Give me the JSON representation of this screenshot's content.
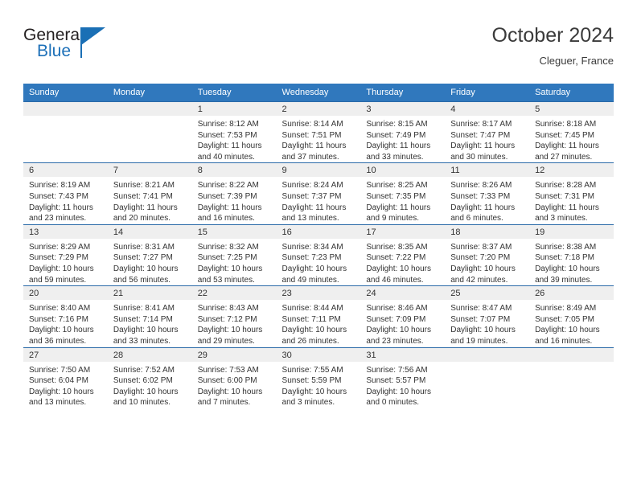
{
  "brand": {
    "name_part1": "General",
    "name_part2": "Blue",
    "flag_icon": "triangle-flag-icon"
  },
  "header": {
    "month_title": "October 2024",
    "location": "Cleguer, France"
  },
  "colors": {
    "header_blue": "#3078bd",
    "row_divider": "#2a6aa8",
    "daynum_band": "#efefef",
    "brand_blue": "#1d70b8",
    "text": "#333333"
  },
  "calendar": {
    "weekday_headers": [
      "Sunday",
      "Monday",
      "Tuesday",
      "Wednesday",
      "Thursday",
      "Friday",
      "Saturday"
    ],
    "labels": {
      "sunrise": "Sunrise:",
      "sunset": "Sunset:",
      "daylight": "Daylight:"
    },
    "weeks": [
      [
        {
          "day": "",
          "sunrise": "",
          "sunset": "",
          "daylight": "",
          "empty": true
        },
        {
          "day": "",
          "sunrise": "",
          "sunset": "",
          "daylight": "",
          "empty": true
        },
        {
          "day": "1",
          "sunrise": "Sunrise: 8:12 AM",
          "sunset": "Sunset: 7:53 PM",
          "daylight": "Daylight: 11 hours and 40 minutes."
        },
        {
          "day": "2",
          "sunrise": "Sunrise: 8:14 AM",
          "sunset": "Sunset: 7:51 PM",
          "daylight": "Daylight: 11 hours and 37 minutes."
        },
        {
          "day": "3",
          "sunrise": "Sunrise: 8:15 AM",
          "sunset": "Sunset: 7:49 PM",
          "daylight": "Daylight: 11 hours and 33 minutes."
        },
        {
          "day": "4",
          "sunrise": "Sunrise: 8:17 AM",
          "sunset": "Sunset: 7:47 PM",
          "daylight": "Daylight: 11 hours and 30 minutes."
        },
        {
          "day": "5",
          "sunrise": "Sunrise: 8:18 AM",
          "sunset": "Sunset: 7:45 PM",
          "daylight": "Daylight: 11 hours and 27 minutes."
        }
      ],
      [
        {
          "day": "6",
          "sunrise": "Sunrise: 8:19 AM",
          "sunset": "Sunset: 7:43 PM",
          "daylight": "Daylight: 11 hours and 23 minutes."
        },
        {
          "day": "7",
          "sunrise": "Sunrise: 8:21 AM",
          "sunset": "Sunset: 7:41 PM",
          "daylight": "Daylight: 11 hours and 20 minutes."
        },
        {
          "day": "8",
          "sunrise": "Sunrise: 8:22 AM",
          "sunset": "Sunset: 7:39 PM",
          "daylight": "Daylight: 11 hours and 16 minutes."
        },
        {
          "day": "9",
          "sunrise": "Sunrise: 8:24 AM",
          "sunset": "Sunset: 7:37 PM",
          "daylight": "Daylight: 11 hours and 13 minutes."
        },
        {
          "day": "10",
          "sunrise": "Sunrise: 8:25 AM",
          "sunset": "Sunset: 7:35 PM",
          "daylight": "Daylight: 11 hours and 9 minutes."
        },
        {
          "day": "11",
          "sunrise": "Sunrise: 8:26 AM",
          "sunset": "Sunset: 7:33 PM",
          "daylight": "Daylight: 11 hours and 6 minutes."
        },
        {
          "day": "12",
          "sunrise": "Sunrise: 8:28 AM",
          "sunset": "Sunset: 7:31 PM",
          "daylight": "Daylight: 11 hours and 3 minutes."
        }
      ],
      [
        {
          "day": "13",
          "sunrise": "Sunrise: 8:29 AM",
          "sunset": "Sunset: 7:29 PM",
          "daylight": "Daylight: 10 hours and 59 minutes."
        },
        {
          "day": "14",
          "sunrise": "Sunrise: 8:31 AM",
          "sunset": "Sunset: 7:27 PM",
          "daylight": "Daylight: 10 hours and 56 minutes."
        },
        {
          "day": "15",
          "sunrise": "Sunrise: 8:32 AM",
          "sunset": "Sunset: 7:25 PM",
          "daylight": "Daylight: 10 hours and 53 minutes."
        },
        {
          "day": "16",
          "sunrise": "Sunrise: 8:34 AM",
          "sunset": "Sunset: 7:23 PM",
          "daylight": "Daylight: 10 hours and 49 minutes."
        },
        {
          "day": "17",
          "sunrise": "Sunrise: 8:35 AM",
          "sunset": "Sunset: 7:22 PM",
          "daylight": "Daylight: 10 hours and 46 minutes."
        },
        {
          "day": "18",
          "sunrise": "Sunrise: 8:37 AM",
          "sunset": "Sunset: 7:20 PM",
          "daylight": "Daylight: 10 hours and 42 minutes."
        },
        {
          "day": "19",
          "sunrise": "Sunrise: 8:38 AM",
          "sunset": "Sunset: 7:18 PM",
          "daylight": "Daylight: 10 hours and 39 minutes."
        }
      ],
      [
        {
          "day": "20",
          "sunrise": "Sunrise: 8:40 AM",
          "sunset": "Sunset: 7:16 PM",
          "daylight": "Daylight: 10 hours and 36 minutes."
        },
        {
          "day": "21",
          "sunrise": "Sunrise: 8:41 AM",
          "sunset": "Sunset: 7:14 PM",
          "daylight": "Daylight: 10 hours and 33 minutes."
        },
        {
          "day": "22",
          "sunrise": "Sunrise: 8:43 AM",
          "sunset": "Sunset: 7:12 PM",
          "daylight": "Daylight: 10 hours and 29 minutes."
        },
        {
          "day": "23",
          "sunrise": "Sunrise: 8:44 AM",
          "sunset": "Sunset: 7:11 PM",
          "daylight": "Daylight: 10 hours and 26 minutes."
        },
        {
          "day": "24",
          "sunrise": "Sunrise: 8:46 AM",
          "sunset": "Sunset: 7:09 PM",
          "daylight": "Daylight: 10 hours and 23 minutes."
        },
        {
          "day": "25",
          "sunrise": "Sunrise: 8:47 AM",
          "sunset": "Sunset: 7:07 PM",
          "daylight": "Daylight: 10 hours and 19 minutes."
        },
        {
          "day": "26",
          "sunrise": "Sunrise: 8:49 AM",
          "sunset": "Sunset: 7:05 PM",
          "daylight": "Daylight: 10 hours and 16 minutes."
        }
      ],
      [
        {
          "day": "27",
          "sunrise": "Sunrise: 7:50 AM",
          "sunset": "Sunset: 6:04 PM",
          "daylight": "Daylight: 10 hours and 13 minutes."
        },
        {
          "day": "28",
          "sunrise": "Sunrise: 7:52 AM",
          "sunset": "Sunset: 6:02 PM",
          "daylight": "Daylight: 10 hours and 10 minutes."
        },
        {
          "day": "29",
          "sunrise": "Sunrise: 7:53 AM",
          "sunset": "Sunset: 6:00 PM",
          "daylight": "Daylight: 10 hours and 7 minutes."
        },
        {
          "day": "30",
          "sunrise": "Sunrise: 7:55 AM",
          "sunset": "Sunset: 5:59 PM",
          "daylight": "Daylight: 10 hours and 3 minutes."
        },
        {
          "day": "31",
          "sunrise": "Sunrise: 7:56 AM",
          "sunset": "Sunset: 5:57 PM",
          "daylight": "Daylight: 10 hours and 0 minutes."
        },
        {
          "day": "",
          "sunrise": "",
          "sunset": "",
          "daylight": "",
          "empty": true
        },
        {
          "day": "",
          "sunrise": "",
          "sunset": "",
          "daylight": "",
          "empty": true
        }
      ]
    ]
  }
}
